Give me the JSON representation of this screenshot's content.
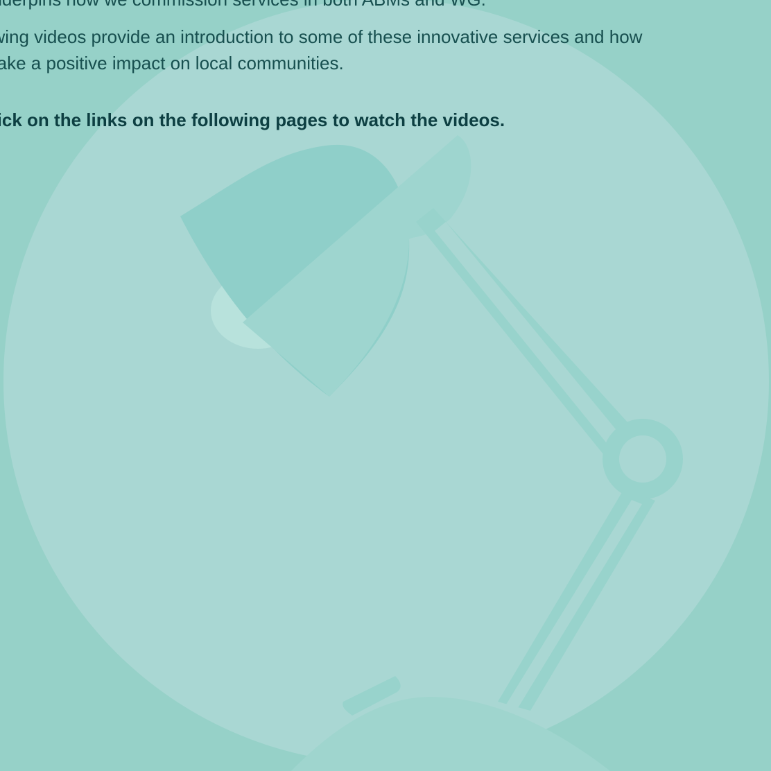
{
  "intro": {
    "line_1": "underpins how we commission services in both ABMs and WG.",
    "line_2": "owing videos provide an introduction to some of these innovative services and how",
    "line_3": "make a positive impact on local communities."
  },
  "cta": {
    "text": "click on the links on the following pages to watch the videos."
  },
  "icons": {
    "illustration": "desk-lamp-icon"
  },
  "colors": {
    "background": "#96d1c8",
    "circle": "#a9d7d3",
    "lamp": "#8fcfc9",
    "text": "#174f4f",
    "accent_text": "#0d3f42"
  }
}
